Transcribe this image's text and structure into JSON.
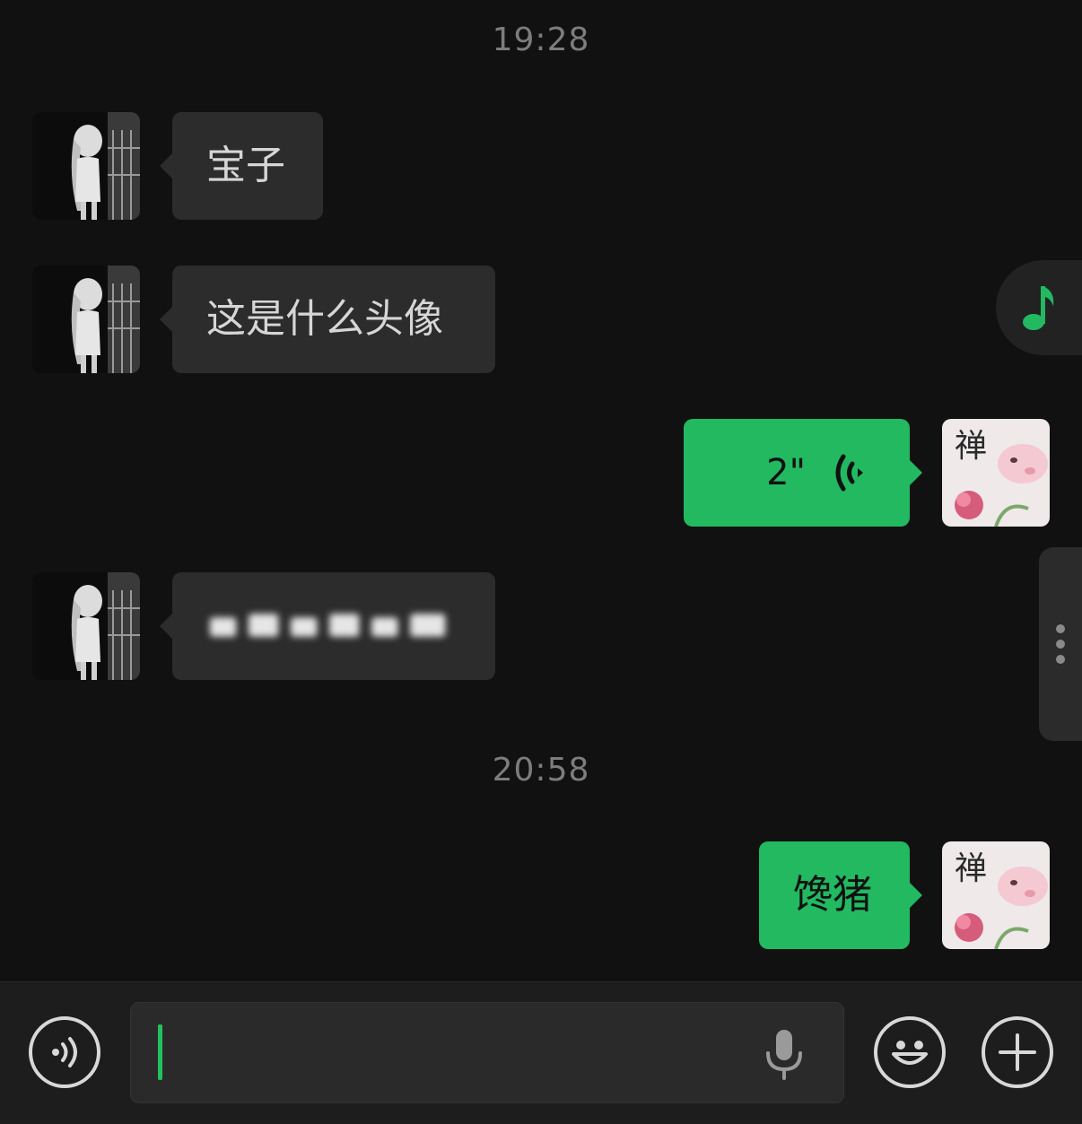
{
  "timestamps": [
    "19:28",
    "20:58"
  ],
  "messages": [
    {
      "direction": "incoming",
      "type": "text",
      "text": "宝子"
    },
    {
      "direction": "incoming",
      "type": "text",
      "text": "这是什么头像"
    },
    {
      "direction": "outgoing",
      "type": "voice",
      "duration": "2\""
    },
    {
      "direction": "incoming",
      "type": "text-blurred",
      "text": ""
    },
    {
      "direction": "outgoing",
      "type": "text",
      "text": "馋猪"
    }
  ],
  "avatars": {
    "contact": "contact-avatar",
    "self": "self-avatar",
    "self_avatar_character": "禅"
  },
  "floating": {
    "music_icon": "music-note-icon",
    "side_handle_icon": "more-vertical-icon"
  },
  "input_bar": {
    "voice_toggle_icon": "voice-mode-icon",
    "mic_icon": "microphone-icon",
    "emoji_icon": "emoji-icon",
    "more_icon": "plus-icon",
    "value": ""
  },
  "colors": {
    "background": "#111111",
    "incoming_bubble": "#2c2c2c",
    "outgoing_bubble": "#22b961",
    "caret": "#22c15e"
  }
}
